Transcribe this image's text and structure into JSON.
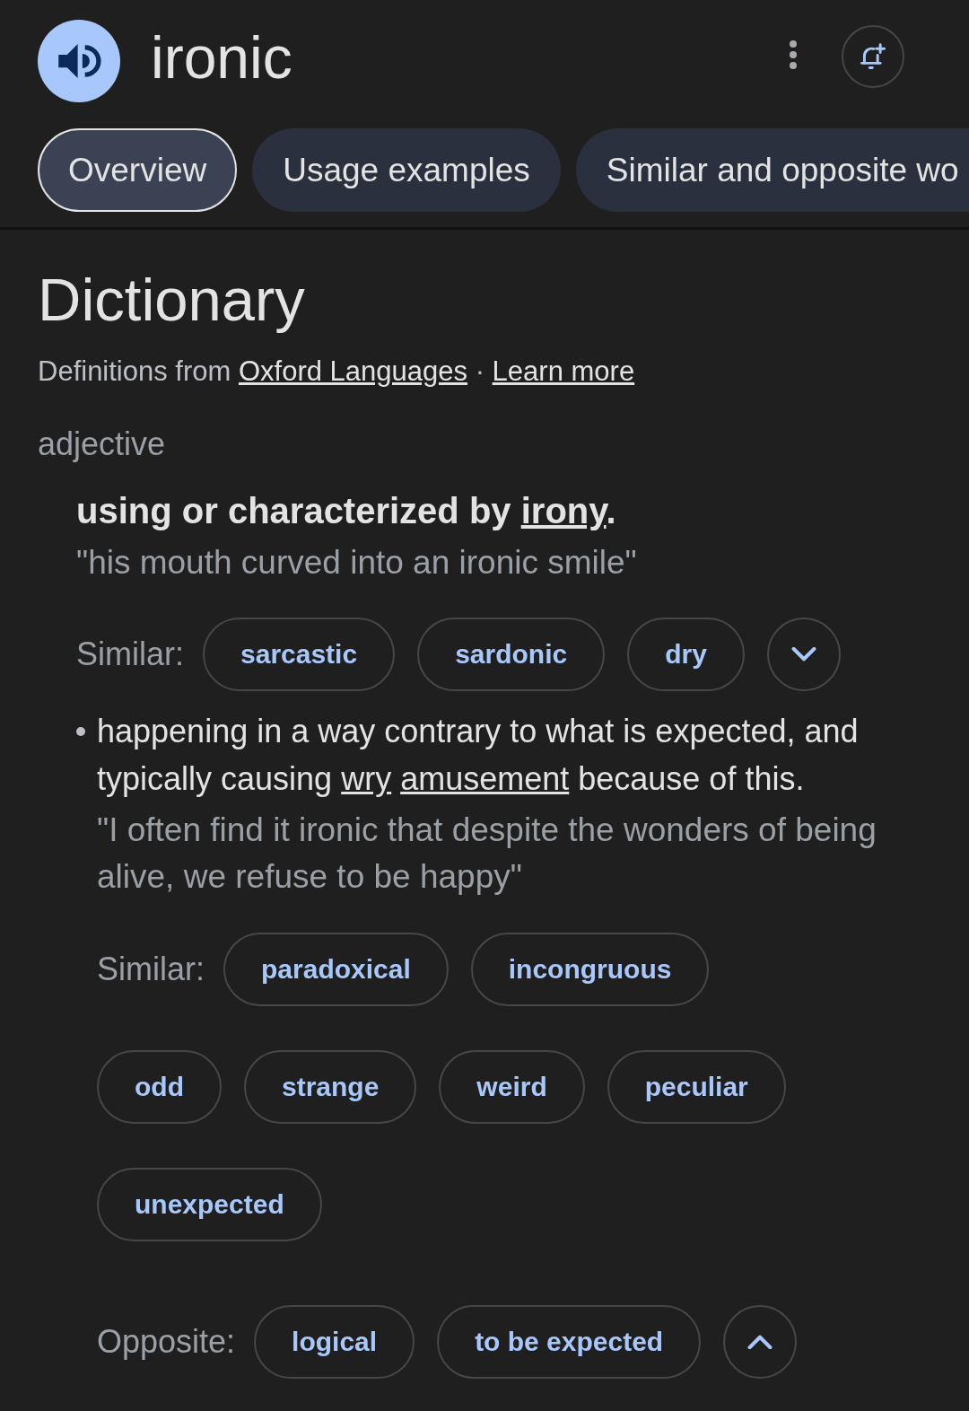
{
  "header": {
    "word": "ironic"
  },
  "tabs": [
    {
      "label": "Overview",
      "selected": true
    },
    {
      "label": "Usage examples",
      "selected": false
    },
    {
      "label": "Similar and opposite wo",
      "selected": false
    }
  ],
  "dictionary": {
    "title": "Dictionary",
    "source": {
      "prefix": "Definitions from",
      "link": "Oxford Languages",
      "separator": "·",
      "more_link": "Learn more"
    },
    "part_of_speech": "adjective",
    "senses": [
      {
        "bulleted": false,
        "definition": [
          {
            "kind": "text",
            "text": "using or characterized by "
          },
          {
            "kind": "link",
            "text": "irony"
          },
          {
            "kind": "text",
            "text": "."
          }
        ],
        "example": "\"his mouth curved into an ironic smile\"",
        "expanded": false,
        "related": [
          {
            "label": "Similar:",
            "words": [
              "sarcastic",
              "sardonic",
              "dry"
            ]
          }
        ]
      },
      {
        "bulleted": true,
        "definition": [
          {
            "kind": "text",
            "text": "happening in a way contrary to what is expected, and typically causing "
          },
          {
            "kind": "link",
            "text": "wry "
          },
          {
            "kind": "link",
            "text": "amusement"
          },
          {
            "kind": "text",
            "text": " because of this."
          }
        ],
        "example": "\"I often find it ironic that despite the wonders of being alive, we refuse to be happy\"",
        "expanded": true,
        "related": [
          {
            "label": "Similar:",
            "words": [
              "paradoxical",
              "incongruous",
              "odd",
              "strange",
              "weird",
              "peculiar",
              "unexpected"
            ]
          },
          {
            "label": "Opposite:",
            "words": [
              "logical",
              "to be expected"
            ]
          }
        ]
      }
    ]
  }
}
